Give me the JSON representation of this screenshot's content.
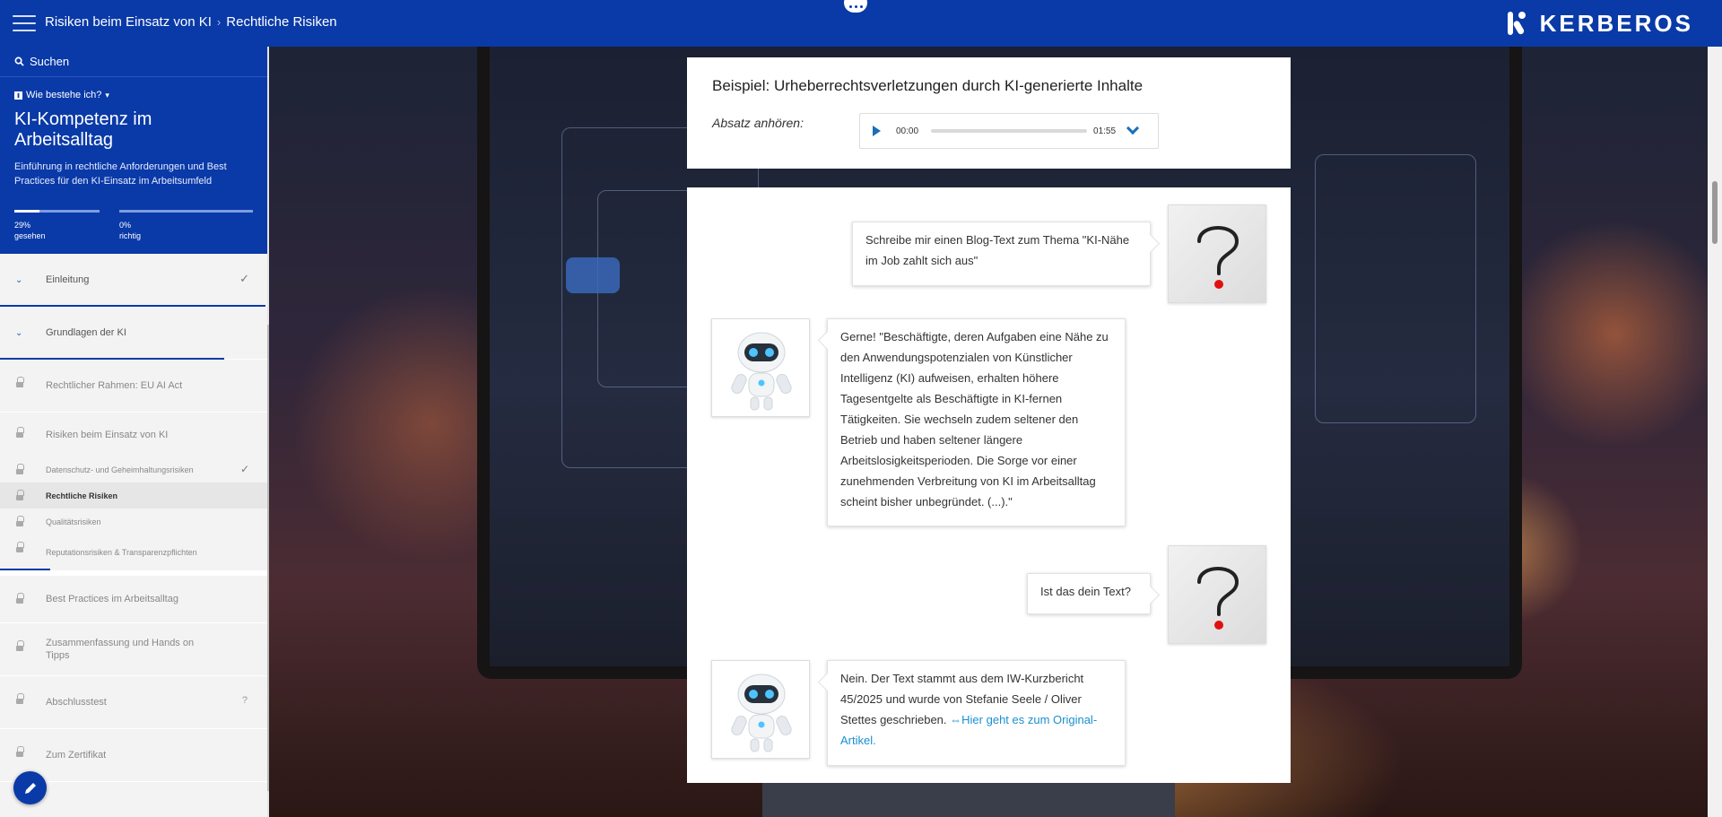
{
  "header": {
    "breadcrumb": [
      "Risiken beim Einsatz von KI",
      "Rechtliche Risiken"
    ],
    "logo_text": "KERBEROS",
    "brand_color": "#0a3aa8"
  },
  "sidebar": {
    "search_label": "Suchen",
    "wie_label": "Wie bestehe ich?",
    "course_title": "KI-Kompetenz im Arbeitsalltag",
    "course_desc": "Einführung in rechtliche Anforderungen und Best Practices für den KI-Einsatz im Arbeitsumfeld",
    "progress": [
      {
        "value": 0.29,
        "pct": "29%",
        "label": "gesehen"
      },
      {
        "value": 0.0,
        "pct": "0%",
        "label": "richtig"
      }
    ],
    "items": [
      {
        "label": "Einleitung",
        "state": "done"
      },
      {
        "label": "Grundlagen der KI",
        "state": "open"
      },
      {
        "label": "Rechtlicher Rahmen: EU AI Act",
        "state": "locked"
      }
    ],
    "risk_group": {
      "label": "Risiken beim Einsatz von KI",
      "subitems": [
        {
          "label": "Datenschutz- und Geheimhaltungsrisiken",
          "state": "done"
        },
        {
          "label": "Rechtliche Risiken",
          "state": "active"
        },
        {
          "label": "Qualitätsrisiken",
          "state": "locked"
        },
        {
          "label": "Reputationsrisiken & Transparenzpflichten",
          "state": "locked"
        }
      ]
    },
    "items_after": [
      {
        "label": "Best Practices im Arbeitsalltag"
      },
      {
        "label": "Zusammenfassung und Hands on Tipps"
      },
      {
        "label": "Abschlusstest",
        "suffix": "?"
      },
      {
        "label": "Zum Zertifikat"
      }
    ]
  },
  "main": {
    "heading": "Beispiel: Urheberrechtsverletzungen durch KI-generierte Inhalte",
    "listen_label": "Absatz anhören:",
    "audio": {
      "current": "00:00",
      "duration": "01:55"
    },
    "chat": [
      {
        "from": "user",
        "text": "Schreibe mir einen Blog-Text zum Thema \"KI-Nähe im Job zahlt sich aus\""
      },
      {
        "from": "bot",
        "text": "Gerne! \"Beschäftigte, deren Aufgaben eine Nähe zu den Anwendungspotenzialen von Künstlicher Intelligenz (KI) aufweisen, erhalten höhere Tagesentgelte als Beschäftigte in KI-fernen Tätigkeiten. Sie wechseln zudem seltener den Betrieb und haben seltener längere Arbeitslosigkeitsperioden. Die Sorge vor einer zunehmenden Verbreitung von KI im Arbeitsalltag scheint bisher unbegründet. (...).\""
      },
      {
        "from": "user",
        "text": "Ist das dein Text?"
      },
      {
        "from": "bot",
        "text": "Nein. Der Text stammt aus dem IW-Kurzbericht 45/2025 und wurde von Stefanie Seele / Oliver Stettes geschrieben.",
        "link": "Hier geht es zum Original-Artikel."
      }
    ]
  }
}
